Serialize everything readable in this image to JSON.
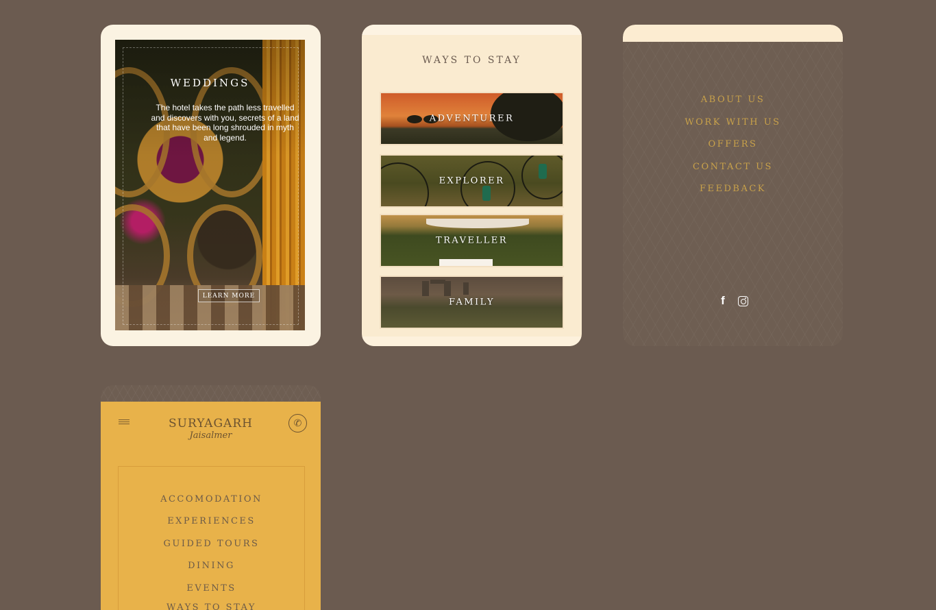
{
  "weddings": {
    "title": "WEDDINGS",
    "description": "The hotel takes the path less travelled and discovers with you, secrets of a land that have been long shrouded in myth and legend.",
    "cta": "LEARN MORE"
  },
  "ways_to_stay": {
    "title": "WAYS TO STAY",
    "options": [
      {
        "label": "ADVENTURER"
      },
      {
        "label": "EXPLORER"
      },
      {
        "label": "TRAVELLER"
      },
      {
        "label": "FAMILY"
      }
    ]
  },
  "footer_menu": {
    "links": [
      "ABOUT US",
      "WORK WITH US",
      "OFFERS",
      "CONTACT US",
      "FEEDBACK"
    ],
    "social": {
      "facebook_icon": "f",
      "instagram_icon": "instagram-icon"
    }
  },
  "mobile_nav": {
    "logo_main": "SURYAGARH",
    "logo_sub": "Jaisalmer",
    "phone_icon": "✆",
    "links": [
      "ACCOMODATION",
      "EXPERIENCES",
      "GUIDED TOURS",
      "DINING",
      "EVENTS",
      "WAYS TO STAY"
    ]
  },
  "colors": {
    "background": "#6b5b50",
    "cream": "#fbf3e2",
    "gold_text": "#c9a24a",
    "mustard": "#e8b24a"
  }
}
